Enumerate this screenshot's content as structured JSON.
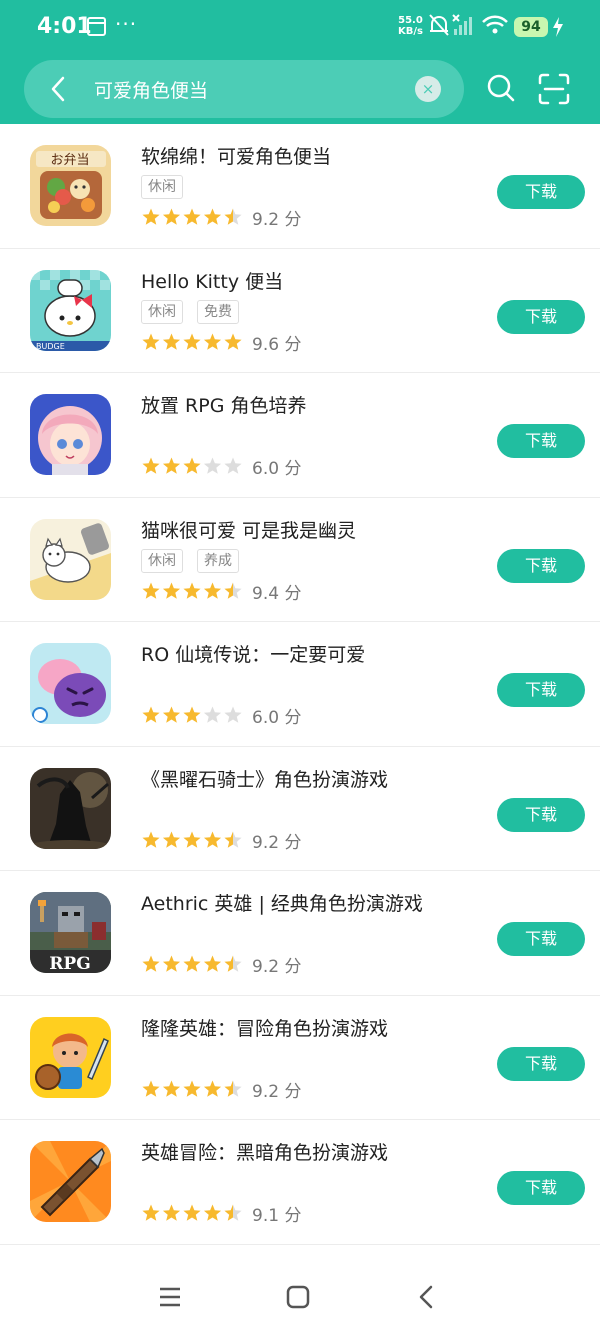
{
  "status_bar": {
    "time": "4:01",
    "more": "···",
    "speed_value": "55.0",
    "speed_unit": "KB/s",
    "battery": "94"
  },
  "search": {
    "query": "可爱角色便当",
    "clear_glyph": "×"
  },
  "colors": {
    "brand": "#21bea0",
    "star_on": "#f7b92e",
    "star_off": "#dddddd"
  },
  "apps": [
    {
      "name": "软绵绵！可爱角色便当",
      "tags": [
        "休闲"
      ],
      "stars": 4.5,
      "score": "9.2 分",
      "download": "下载",
      "icon": "bento-food-icon"
    },
    {
      "name": "Hello Kitty 便当",
      "tags": [
        "休闲",
        "免费"
      ],
      "stars": 5,
      "score": "9.6 分",
      "download": "下载",
      "icon": "hello-kitty-chef-icon",
      "icon_text": "BUDGE"
    },
    {
      "name": "放置 RPG 角色培养",
      "tags": [],
      "stars": 3,
      "score": "6.0 分",
      "download": "下载",
      "icon": "anime-girl-icon"
    },
    {
      "name": "猫咪很可爱 可是我是幽灵",
      "tags": [
        "休闲",
        "养成"
      ],
      "stars": 4.5,
      "score": "9.4 分",
      "download": "下载",
      "icon": "cat-ghost-icon"
    },
    {
      "name": "RO 仙境传说：一定要可爱",
      "tags": [],
      "stars": 3,
      "score": "6.0 分",
      "download": "下载",
      "icon": "poring-slime-icon"
    },
    {
      "name": "《黑曜石骑士》角色扮演游戏",
      "tags": [],
      "stars": 4.5,
      "score": "9.2 分",
      "download": "下载",
      "icon": "dark-knight-icon"
    },
    {
      "name": "Aethric 英雄 | 经典角色扮演游戏",
      "tags": [],
      "stars": 4.5,
      "score": "9.2 分",
      "download": "下载",
      "icon": "pixel-knight-rpg-icon",
      "icon_text": "RPG"
    },
    {
      "name": "隆隆英雄：冒险角色扮演游戏",
      "tags": [],
      "stars": 4.5,
      "score": "9.2 分",
      "download": "下载",
      "icon": "cartoon-hero-icon"
    },
    {
      "name": "英雄冒险：黑暗角色扮演游戏",
      "tags": [],
      "stars": 4.5,
      "score": "9.1 分",
      "download": "下载",
      "icon": "rocket-gun-icon"
    }
  ]
}
